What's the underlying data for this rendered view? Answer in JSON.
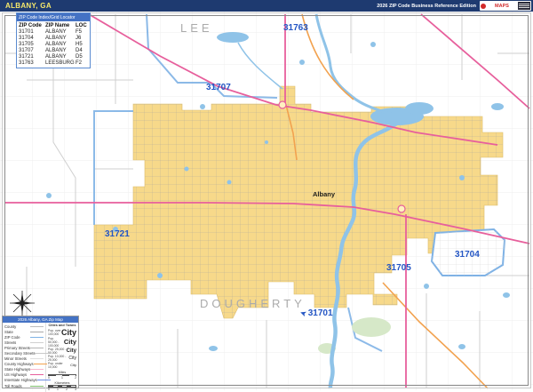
{
  "header": {
    "title": "ALBANY, GA",
    "edition": "2026 ZIP Code Business Reference Edition",
    "logo_text": "MAPS"
  },
  "zip_table": {
    "title": "ZIP Code Index/Grid Locator",
    "columns": [
      "ZIP Code",
      "ZIP Name",
      "LOC"
    ],
    "rows": [
      [
        "31701",
        "ALBANY",
        "F5"
      ],
      [
        "31704",
        "ALBANY",
        "J6"
      ],
      [
        "31705",
        "ALBANY",
        "H5"
      ],
      [
        "31707",
        "ALBANY",
        "D4"
      ],
      [
        "31721",
        "ALBANY",
        "D5"
      ],
      [
        "31763",
        "LEESBURG",
        "F2"
      ]
    ]
  },
  "map": {
    "county_labels": [
      "LEE",
      "DOUGHERTY"
    ],
    "city_label": "Albany",
    "zip_labels": [
      "31763",
      "31707",
      "31721",
      "31705",
      "31704",
      "31701"
    ]
  },
  "legend": {
    "title": "2026 Albany, GA Zip Map",
    "line_items": [
      "County",
      "State",
      "ZIP Code",
      "Streets",
      "Primary Streets",
      "Secondary Streets",
      "Minor Streets",
      "County Highways",
      "State Highways",
      "US Highways",
      "Interstate Highways",
      "Toll Roads"
    ],
    "city_key": {
      "title": "Cities and Towns",
      "items": [
        {
          "range": "Pop. over 100,000",
          "sample": "City"
        },
        {
          "range": "Pop. 50,000 - 100,000",
          "sample": "City"
        },
        {
          "range": "Pop. 25,000 - 50,000",
          "sample": "City"
        },
        {
          "range": "Pop. 10,000 - 25,000",
          "sample": "City"
        },
        {
          "range": "Pop. under 10,000",
          "sample": "City"
        }
      ]
    },
    "scale": {
      "miles_label": "Miles",
      "miles_ticks": [
        "0",
        "1",
        "2"
      ],
      "km_label": "Kilometers",
      "km_ticks": [
        "0",
        "1",
        "2",
        "3"
      ]
    }
  },
  "colors": {
    "header_bar": "#1E3A70",
    "title_text": "#F7E96B",
    "zip_area_fill": "#F7D98A",
    "zip_label": "#2456C4",
    "county_label": "#ABABAB",
    "water": "#8FC3E8",
    "zip_boundary": "#7FB2E5",
    "us_highway": "#E75F9C",
    "county_highway": "#F2A24F",
    "table_header": "#4472C4"
  }
}
